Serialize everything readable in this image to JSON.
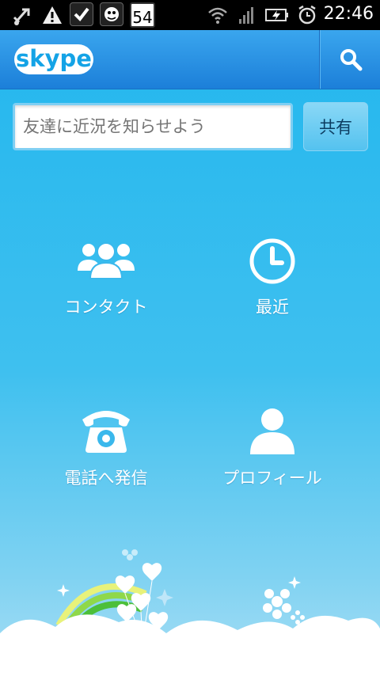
{
  "status_bar": {
    "time": "22:46",
    "calendar_day": "54"
  },
  "header": {
    "logo_text": "skype"
  },
  "status_update": {
    "placeholder": "友達に近況を知らせよう",
    "share_label": "共有"
  },
  "menu": {
    "contacts": "コンタクト",
    "recent": "最近",
    "call": "電話へ発信",
    "profile": "プロフィール"
  }
}
